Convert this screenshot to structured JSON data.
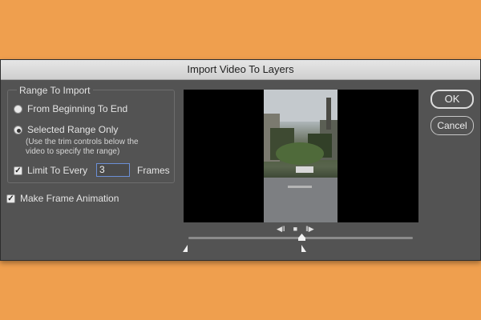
{
  "dialog": {
    "title": "Import Video To Layers",
    "range_group_title": "Range To Import",
    "option_beginning_to_end": "From Beginning To End",
    "option_selected_range": "Selected Range Only",
    "selected_range_hint_line1": "(Use the trim controls below the",
    "selected_range_hint_line2": "video to specify the range)",
    "limit_label": "Limit To Every",
    "limit_value": "3",
    "frames_label": "Frames",
    "make_animation_label": "Make Frame Animation",
    "ok_label": "OK",
    "cancel_label": "Cancel",
    "selected_option": "selected_range",
    "limit_checked": true,
    "make_animation_checked": true,
    "playhead_fraction": 0.5
  },
  "colors": {
    "background": "#ef9f4e",
    "dialog": "#535353",
    "input_focus": "#6b8fd6"
  }
}
